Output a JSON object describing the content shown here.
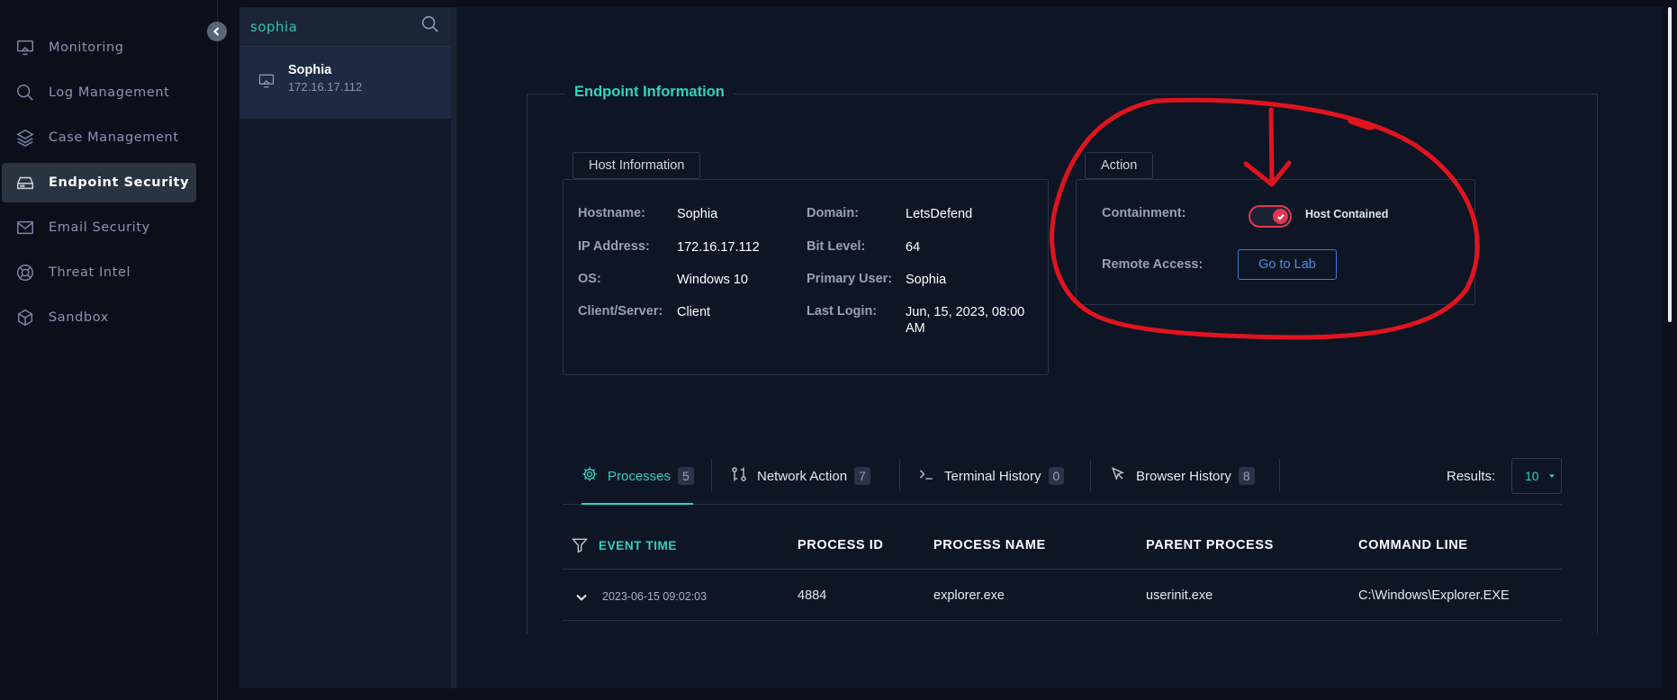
{
  "nav": {
    "items": [
      {
        "label": "Monitoring",
        "icon": "monitor-icon"
      },
      {
        "label": "Log Management",
        "icon": "search-icon"
      },
      {
        "label": "Case Management",
        "icon": "layers-icon"
      },
      {
        "label": "Endpoint Security",
        "icon": "hard-drive-icon",
        "active": true
      },
      {
        "label": "Email Security",
        "icon": "mail-icon"
      },
      {
        "label": "Threat Intel",
        "icon": "lifebuoy-icon"
      },
      {
        "label": "Sandbox",
        "icon": "box-icon"
      }
    ]
  },
  "host_panel": {
    "search_value": "sophia",
    "host": {
      "name": "Sophia",
      "ip": "172.16.17.112"
    }
  },
  "endpoint": {
    "title": "Endpoint Information",
    "host_info": {
      "tab_label": "Host Information",
      "hostname_label": "Hostname:",
      "hostname": "Sophia",
      "ip_label": "IP Address:",
      "ip": "172.16.17.112",
      "os_label": "OS:",
      "os": "Windows 10",
      "cs_label": "Client/Server:",
      "cs": "Client",
      "domain_label": "Domain:",
      "domain": "LetsDefend",
      "bit_label": "Bit Level:",
      "bit": "64",
      "user_label": "Primary User:",
      "user": "Sophia",
      "login_label": "Last Login:",
      "login_line1": "Jun, 15, 2023, 08:00",
      "login_line2": "AM"
    },
    "action": {
      "tab_label": "Action",
      "containment_label": "Containment:",
      "containment_state": "Host Contained",
      "remote_label": "Remote Access:",
      "lab_button": "Go to Lab"
    }
  },
  "tabs": [
    {
      "label": "Processes",
      "count": "5",
      "active": true
    },
    {
      "label": "Network Action",
      "count": "7"
    },
    {
      "label": "Terminal History",
      "count": "0"
    },
    {
      "label": "Browser History",
      "count": "8"
    }
  ],
  "results": {
    "label": "Results:",
    "value": "10"
  },
  "table": {
    "headers": [
      "EVENT TIME",
      "PROCESS ID",
      "PROCESS NAME",
      "PARENT PROCESS",
      "COMMAND LINE"
    ],
    "rows": [
      {
        "event_time": "2023-06-15 09:02:03",
        "process_id": "4884",
        "process_name": "explorer.exe",
        "parent_process": "userinit.exe",
        "command_line": "C:\\Windows\\Explorer.EXE"
      }
    ]
  },
  "colors": {
    "accent": "#2ed3c2",
    "annotation": "#e0141e",
    "toggle": "#e0394f",
    "link": "#4a90e6"
  }
}
